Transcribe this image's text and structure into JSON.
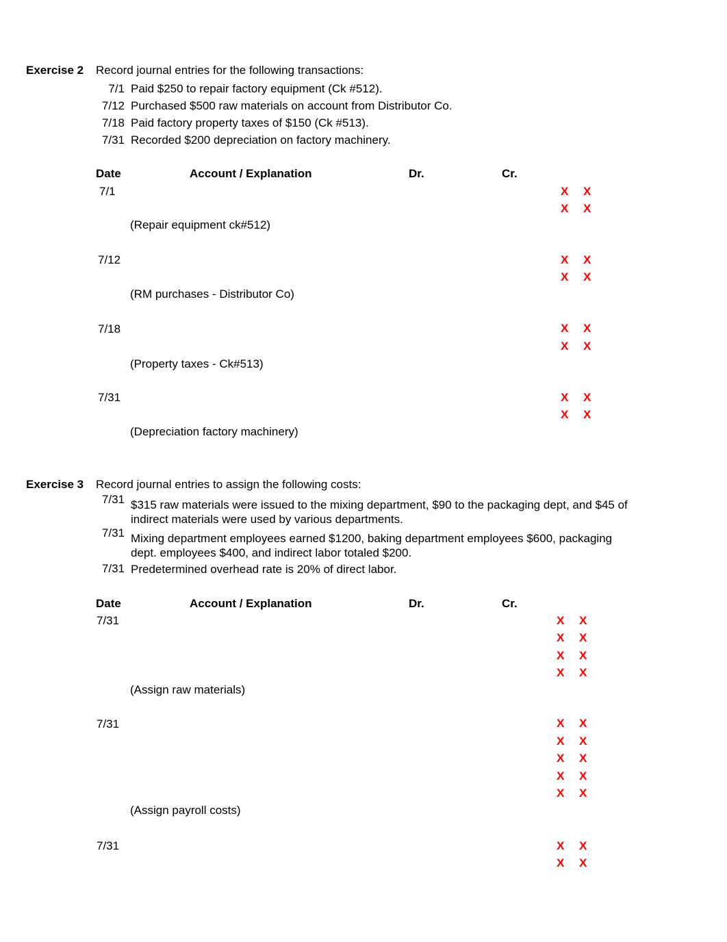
{
  "document": {
    "background": "#ffffff",
    "text_color": "#000000",
    "marker_color": "#FF0000",
    "marker_glyph": "X"
  },
  "exercise2": {
    "label": "Exercise 2",
    "intro": "Record journal entries for the following transactions:",
    "transactions": [
      {
        "date": "7/1",
        "text": "Paid $250 to repair factory equipment (Ck #512)."
      },
      {
        "date": "7/12",
        "text": "Purchased $500 raw materials on account from Distributor Co."
      },
      {
        "date": "7/18",
        "text": "Paid factory property taxes of $150 (Ck #513)."
      },
      {
        "date": "7/31",
        "text": "Recorded  $200 depreciation on factory machinery."
      }
    ],
    "table": {
      "headers": {
        "date": "Date",
        "account": "Account / Explanation",
        "dr": "Dr.",
        "cr": "Cr."
      },
      "entries": [
        {
          "date": "7/1",
          "explanation": "(Repair equipment ck#512)",
          "marker_rows": 2
        },
        {
          "date": "7/12",
          "explanation": "(RM purchases - Distributor Co)",
          "marker_rows": 2
        },
        {
          "date": "7/18",
          "explanation": "(Property taxes - Ck#513)",
          "marker_rows": 2
        },
        {
          "date": "7/31",
          "explanation": "(Depreciation factory machinery)",
          "marker_rows": 2
        }
      ]
    }
  },
  "exercise3": {
    "label": "Exercise 3",
    "intro": "Record journal entries to assign the following costs:",
    "transactions": [
      {
        "date": "7/31",
        "text": "$315 raw materials were issued to the mixing department, $90 to the packaging dept, and $45 of indirect materials were used by various departments."
      },
      {
        "date": "7/31",
        "text": "Mixing department employees earned $1200, baking department employees $600, packaging dept. employees $400, and indirect labor totaled $200."
      },
      {
        "date": "7/31",
        "text": "Predetermined overhead rate is 20% of direct labor."
      }
    ],
    "table": {
      "headers": {
        "date": "Date",
        "account": "Account / Explanation",
        "dr": "Dr.",
        "cr": "Cr."
      },
      "entries": [
        {
          "date": "7/31",
          "explanation": "(Assign raw materials)",
          "marker_rows": 4
        },
        {
          "date": "7/31",
          "explanation": "(Assign payroll costs)",
          "marker_rows": 5
        },
        {
          "date": "7/31",
          "explanation": "",
          "marker_rows": 2
        }
      ]
    }
  }
}
